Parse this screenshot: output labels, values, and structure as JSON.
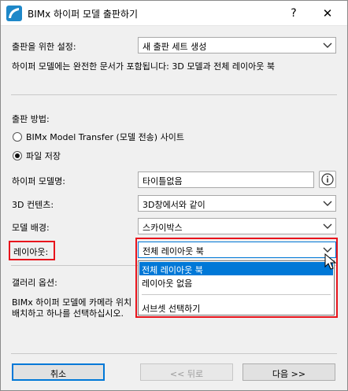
{
  "window": {
    "title": "BIMx 하이퍼 모델 출판하기",
    "help_label": "?",
    "close_label": "✕"
  },
  "settings": {
    "label": "출판을 위한 설정:",
    "value": "새 출판 세트 생성",
    "info_text": "하이퍼 모델에는 완전한 문서가 포함됩니다: 3D 모델과 전체 레이아웃 북"
  },
  "method": {
    "label": "출판 방법:",
    "options": [
      {
        "label": "BIMx Model Transfer (모델 전송) 사이트",
        "selected": false
      },
      {
        "label": "파일 저장",
        "selected": true
      }
    ]
  },
  "fields": {
    "model_name": {
      "label": "하이퍼 모델명:",
      "value": "타이틀없음",
      "info_icon": "info-icon"
    },
    "contents_3d": {
      "label": "3D 컨텐츠:",
      "value": "3D창에서와 같이"
    },
    "background": {
      "label": "모델 배경:",
      "value": "스카이박스"
    },
    "layout": {
      "label": "레이아웃:",
      "value": "전체 레이아웃 북",
      "options": [
        "전체 레이아웃 북",
        "레이아웃 없음",
        "서브셋 선택하기"
      ],
      "highlighted_index": 0
    }
  },
  "gallery": {
    "label": "갤러리 옵션:",
    "text_line1": "BIMx 하이퍼 모델에 카메라 위치",
    "text_line2": "배치하고 하나를 선택하십시오."
  },
  "buttons": {
    "cancel": "취소",
    "back": "<< 뒤로",
    "next": "다음 >>"
  },
  "colors": {
    "highlight": "#0078d7",
    "annotation_red": "#e8141c"
  }
}
